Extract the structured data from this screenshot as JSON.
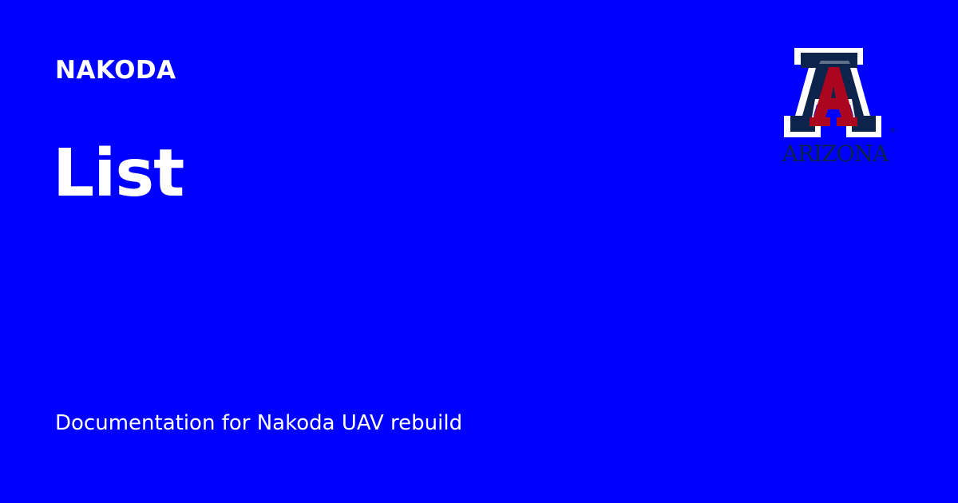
{
  "header": {
    "site_name": "NAKODA"
  },
  "main": {
    "title": "List",
    "description": "Documentation for Nakoda UAV rebuild"
  },
  "logo": {
    "icon": "university-of-arizona-block-a-logo",
    "wordmark": "ARIZONA",
    "registered_mark": "®"
  },
  "colors": {
    "background": "#0000ff",
    "text": "#ffffff",
    "logo_navy": "#0c234b",
    "logo_red": "#ab0520",
    "logo_white": "#ffffff"
  }
}
